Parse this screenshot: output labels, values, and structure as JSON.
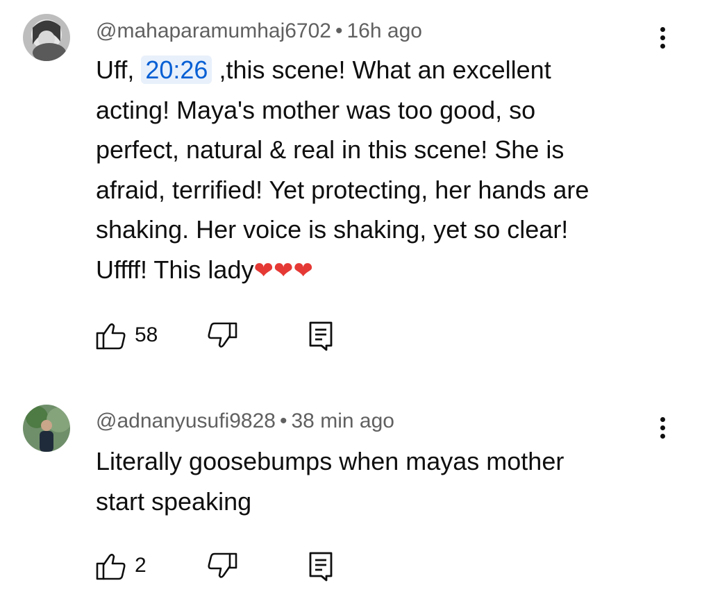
{
  "comments": [
    {
      "author": "@mahaparamumhaj6702",
      "separator": "•",
      "time": "16h ago",
      "lines": [
        {
          "before": "Uff, ",
          "timestamp": "20:26",
          "after": " ,this scene! What an excellent"
        },
        {
          "text": "acting! Maya's mother was too good, so"
        },
        {
          "text": "perfect, natural & real in this scene! She is"
        },
        {
          "text": "afraid, terrified! Yet protecting, her hands are"
        },
        {
          "text": "shaking. Her voice is shaking, yet so clear!"
        },
        {
          "text": "Uffff! This lady",
          "hearts": "❤❤❤"
        }
      ],
      "likes": "58"
    },
    {
      "author": "@adnanyusufi9828",
      "separator": "•",
      "time": "38 min ago",
      "lines": [
        {
          "text": "Literally goosebumps when mayas mother"
        },
        {
          "text": "start speaking"
        }
      ],
      "likes": "2"
    }
  ],
  "icons": {
    "like": "thumbs-up-icon",
    "dislike": "thumbs-down-icon",
    "reply": "reply-icon",
    "menu": "more-vert-icon"
  },
  "colors": {
    "link": "#065fd4",
    "heart": "#e53935",
    "meta": "#606060"
  }
}
